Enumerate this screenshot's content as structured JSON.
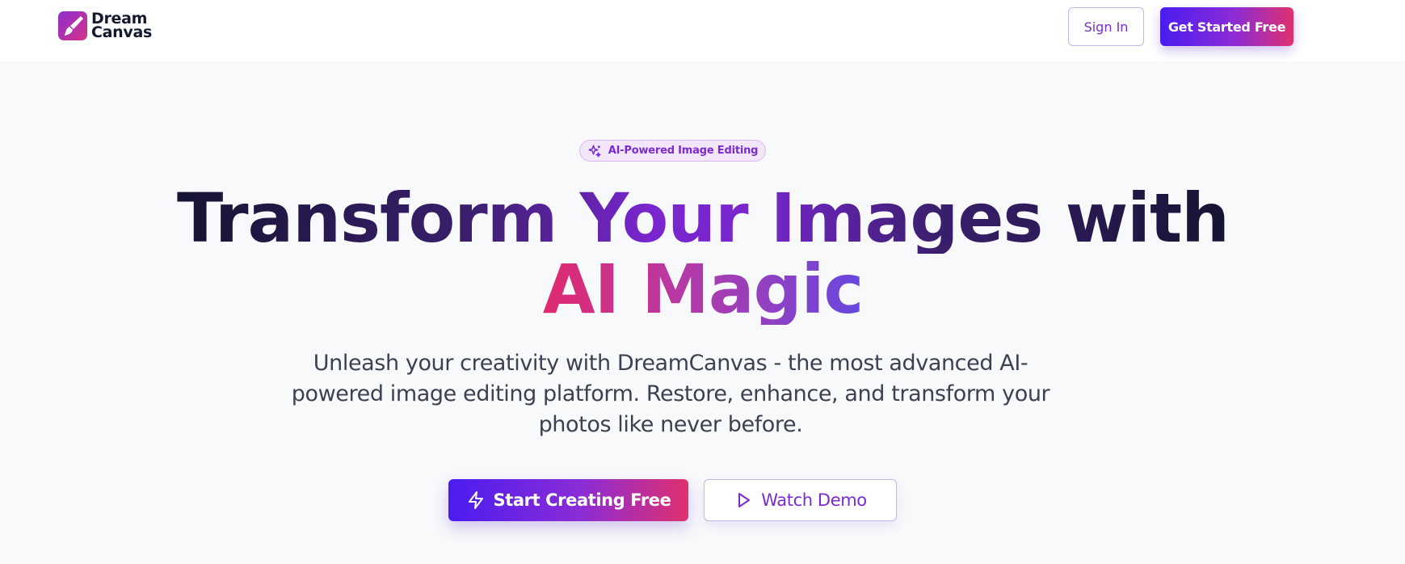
{
  "nav": {
    "logo": {
      "line1": "Dream",
      "line2": "Canvas",
      "icon": "paintbrush-icon"
    },
    "sign_in": "Sign In",
    "get_started": "Get Started Free"
  },
  "hero": {
    "badge": {
      "icon": "sparkles-icon",
      "label": "AI-Powered Image Editing"
    },
    "headline": {
      "line1": "Transform Your Images with",
      "line2": "AI Magic"
    },
    "subtitle": "Unleash your creativity with DreamCanvas - the most advanced AI-powered image editing platform. Restore, enhance, and transform your photos like never before.",
    "cta_primary": {
      "icon": "lightning-icon",
      "label": "Start Creating Free"
    },
    "cta_secondary": {
      "icon": "play-icon",
      "label": "Watch Demo"
    }
  },
  "colors": {
    "brand_purple": "#7b2cd0",
    "brand_indigo": "#4a1cf0",
    "brand_pink": "#e0306e",
    "heading_dark": "#151432",
    "body_text": "#3a4252",
    "background": "#f8f9fb"
  }
}
